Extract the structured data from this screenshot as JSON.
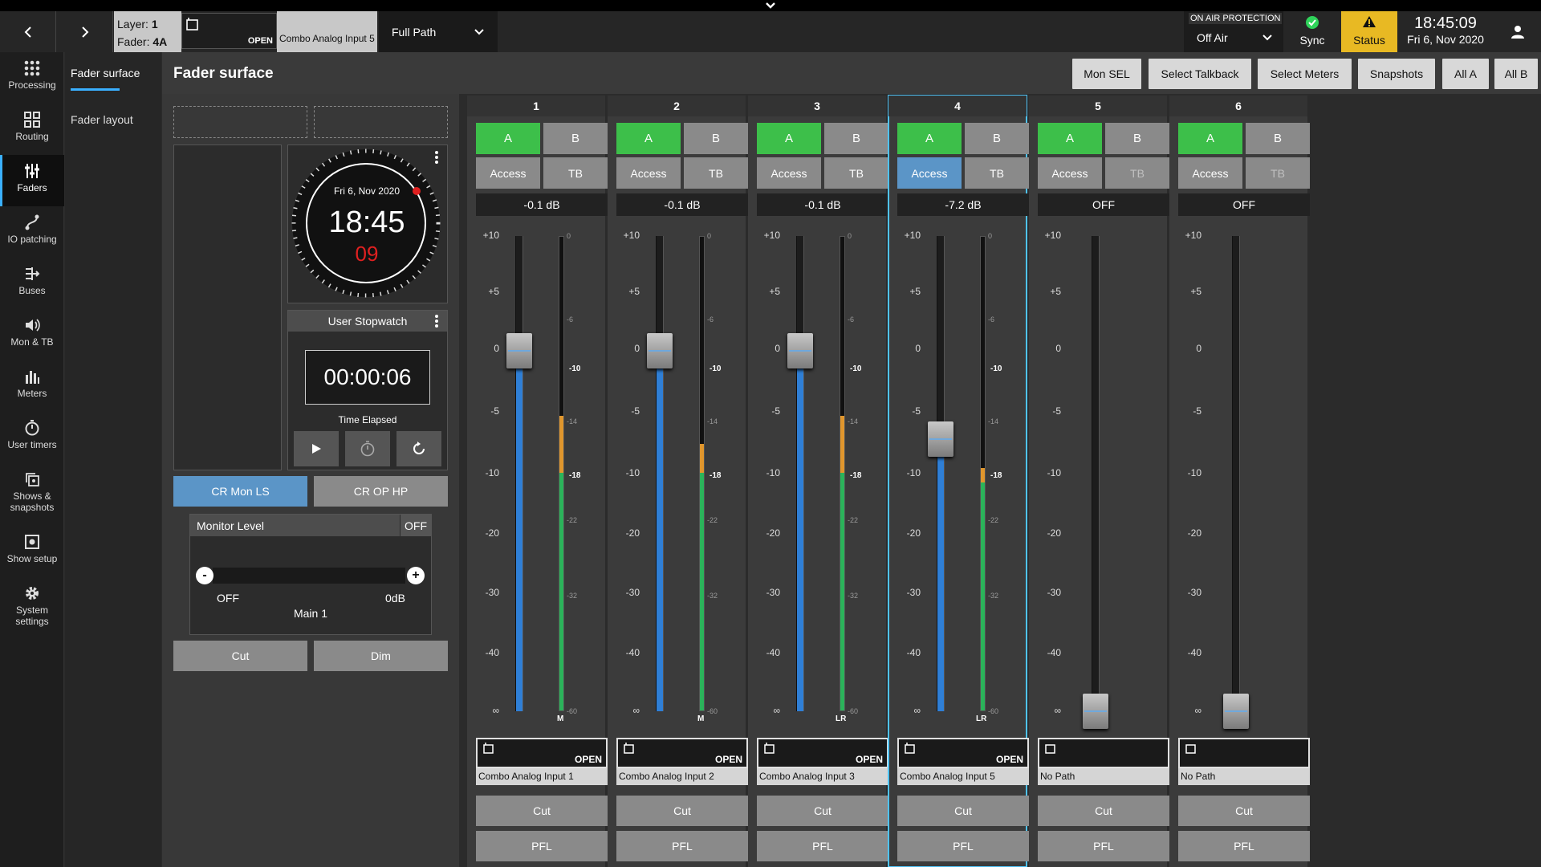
{
  "topbar": {
    "layer_label": "Layer:",
    "layer_value": "1",
    "fader_label": "Fader:",
    "fader_value": "4A",
    "selected_state": "OPEN",
    "selected_path": "Combo Analog Input 5",
    "path_mode": "Full Path",
    "on_air_title": "ON AIR PROTECTION",
    "on_air_value": "Off Air",
    "sync_label": "Sync",
    "status_label": "Status",
    "time": "18:45:09",
    "date": "Fri 6, Nov 2020",
    "colors": {
      "sync": "#2fd35a",
      "status_bg": "#e8b923",
      "accent": "#3ab0ff"
    }
  },
  "nav": {
    "items": [
      {
        "label": "Processing",
        "icon": "grid-icon"
      },
      {
        "label": "Routing",
        "icon": "routing-icon"
      },
      {
        "label": "Faders",
        "icon": "sliders-icon"
      },
      {
        "label": "IO patching",
        "icon": "patch-icon"
      },
      {
        "label": "Buses",
        "icon": "buses-icon"
      },
      {
        "label": "Mon & TB",
        "icon": "speaker-icon"
      },
      {
        "label": "Meters",
        "icon": "meters-icon"
      },
      {
        "label": "User timers",
        "icon": "timer-icon"
      },
      {
        "label": "Shows &",
        "label2": "snapshots",
        "icon": "snapshots-icon"
      },
      {
        "label": "Show setup",
        "icon": "setup-icon"
      },
      {
        "label": "System",
        "label2": "settings",
        "icon": "gear-icon"
      }
    ]
  },
  "subnav": {
    "items": [
      "Fader surface",
      "Fader layout"
    ]
  },
  "header": {
    "title": "Fader surface",
    "buttons": [
      "Mon SEL",
      "Select Talkback",
      "Select Meters",
      "Snapshots",
      "All A",
      "All B"
    ]
  },
  "clock": {
    "date": "Fri 6, Nov 2020",
    "time": "18:45",
    "seconds": "09"
  },
  "stopwatch": {
    "title": "User Stopwatch",
    "value": "00:00:06",
    "caption": "Time Elapsed"
  },
  "monitor": {
    "mon_ls": "CR Mon LS",
    "op_hp": "CR OP HP",
    "level_title": "Monitor Level",
    "level_state": "OFF",
    "min_label": "OFF",
    "max_label": "0dB",
    "bus": "Main 1",
    "cut": "Cut",
    "dim": "Dim",
    "minus": "-",
    "plus": "+"
  },
  "fader_scale": [
    "+10",
    "+5",
    "0",
    "-5",
    "-10",
    "-20",
    "-30",
    "-40",
    "∞"
  ],
  "meter_scale": [
    "0",
    "-6",
    "-10",
    "-14",
    "-18",
    "-22",
    "-32",
    "-60"
  ],
  "strip_labels": {
    "a": "A",
    "b": "B",
    "access": "Access",
    "tb": "TB",
    "cut": "Cut",
    "pfl": "PFL"
  },
  "strips": [
    {
      "num": "1",
      "gain": "-0.1 dB",
      "fader_db": -0.1,
      "path": "Combo Analog Input 1",
      "state": "OPEN",
      "meter": "M",
      "access_on": false,
      "tb_disabled": false,
      "selected": false,
      "meter_level": 0.5,
      "meter_amber": 0.12
    },
    {
      "num": "2",
      "gain": "-0.1 dB",
      "fader_db": -0.1,
      "path": "Combo Analog Input 2",
      "state": "OPEN",
      "meter": "M",
      "access_on": false,
      "tb_disabled": false,
      "selected": false,
      "meter_level": 0.5,
      "meter_amber": 0.06
    },
    {
      "num": "3",
      "gain": "-0.1 dB",
      "fader_db": -0.1,
      "path": "Combo Analog Input 3",
      "state": "OPEN",
      "meter": "LR",
      "access_on": false,
      "tb_disabled": false,
      "selected": false,
      "meter_level": 0.5,
      "meter_amber": 0.12
    },
    {
      "num": "4",
      "gain": "-7.2 dB",
      "fader_db": -7.2,
      "path": "Combo Analog Input 5",
      "state": "OPEN",
      "meter": "LR",
      "access_on": true,
      "tb_disabled": false,
      "selected": true,
      "meter_level": 0.48,
      "meter_amber": 0.03
    },
    {
      "num": "5",
      "gain": "OFF",
      "fader_db": null,
      "path": "No Path",
      "state": "",
      "meter": "",
      "access_on": false,
      "tb_disabled": true,
      "selected": false,
      "meter_level": 0,
      "meter_amber": 0
    },
    {
      "num": "6",
      "gain": "OFF",
      "fader_db": null,
      "path": "No Path",
      "state": "",
      "meter": "",
      "access_on": false,
      "tb_disabled": true,
      "selected": false,
      "meter_level": 0,
      "meter_amber": 0
    }
  ]
}
